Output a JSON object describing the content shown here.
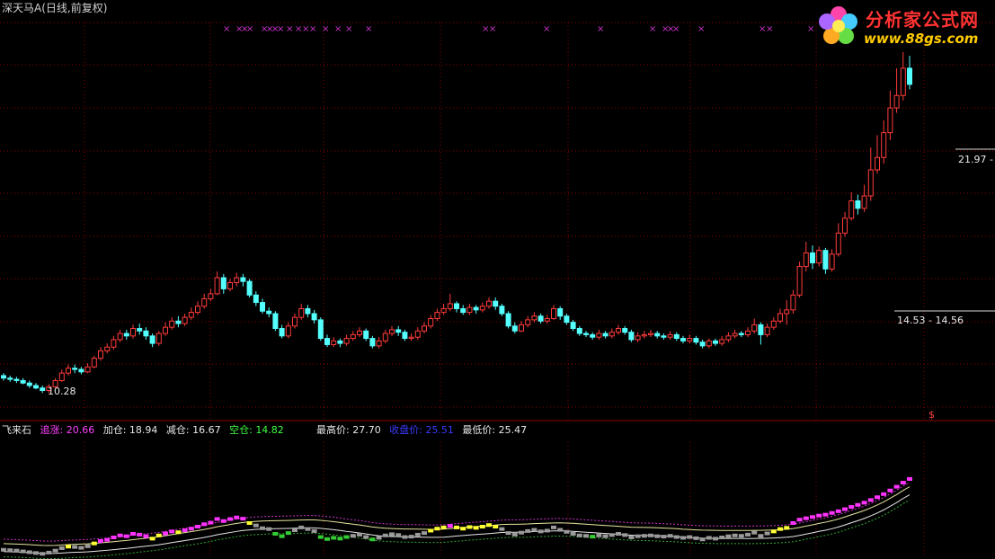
{
  "header": {
    "title": "深天马A",
    "period": "(日线,前复权)"
  },
  "logo": {
    "name": "分析家公式网",
    "url": "www.88gs.com"
  },
  "price_labels": {
    "high_box": "21.97 -",
    "mid_box": "14.53 - 14.56",
    "low_mark": "10.28"
  },
  "signal_marker": "$",
  "indicator": {
    "name": "飞来石",
    "items": [
      {
        "label": "追涨",
        "value": "20.66",
        "color": "#ff40ff"
      },
      {
        "label": "加仓",
        "value": "18.94",
        "color": "#e6e6e6"
      },
      {
        "label": "减仓",
        "value": "16.67",
        "color": "#e6e6e6"
      },
      {
        "label": "空仓",
        "value": "14.82",
        "color": "#40ff40"
      }
    ],
    "stats": [
      {
        "label": "最高价",
        "value": "27.70",
        "color": "#e6e6e6"
      },
      {
        "label": "收盘价",
        "value": "25.51",
        "color": "#3a3aff"
      },
      {
        "label": "最低价",
        "value": "25.47",
        "color": "#e6e6e6"
      }
    ]
  },
  "colors": {
    "up": "#ff3b3b",
    "down": "#54ffff",
    "grid": "#8b0000",
    "markers": "#cc33cc"
  },
  "chart_data": {
    "type": "candlestick",
    "series": [
      {
        "name": "price",
        "values": [
          [
            12.0,
            11.8,
            12.2,
            11.6
          ],
          [
            11.8,
            11.7,
            12.0,
            11.5
          ],
          [
            11.7,
            11.6,
            11.9,
            11.4
          ],
          [
            11.6,
            11.4,
            11.8,
            11.3
          ],
          [
            11.4,
            11.2,
            11.6,
            11.0
          ],
          [
            11.2,
            11.0,
            11.4,
            10.9
          ],
          [
            11.0,
            10.8,
            11.2,
            10.6
          ],
          [
            10.8,
            11.1,
            11.3,
            10.6
          ],
          [
            11.1,
            11.6,
            11.8,
            11.0
          ],
          [
            11.6,
            12.2,
            12.5,
            11.5
          ],
          [
            12.2,
            12.6,
            12.9,
            12.0
          ],
          [
            12.6,
            12.5,
            12.9,
            12.2
          ],
          [
            12.5,
            12.3,
            12.7,
            12.1
          ],
          [
            12.3,
            12.7,
            13.0,
            12.2
          ],
          [
            12.7,
            13.4,
            13.6,
            12.6
          ],
          [
            13.4,
            14.0,
            14.3,
            13.2
          ],
          [
            14.0,
            14.3,
            14.6,
            13.8
          ],
          [
            14.3,
            14.9,
            15.2,
            14.1
          ],
          [
            14.9,
            15.4,
            15.7,
            14.7
          ],
          [
            15.4,
            15.2,
            15.7,
            14.9
          ],
          [
            15.2,
            15.8,
            16.1,
            15.0
          ],
          [
            15.8,
            15.6,
            16.2,
            15.3
          ],
          [
            15.6,
            15.2,
            15.9,
            14.9
          ],
          [
            15.2,
            14.6,
            15.4,
            14.3
          ],
          [
            14.6,
            15.4,
            15.6,
            14.4
          ],
          [
            15.4,
            15.9,
            16.3,
            15.2
          ],
          [
            15.9,
            16.4,
            16.7,
            15.7
          ],
          [
            16.4,
            16.2,
            16.8,
            15.9
          ],
          [
            16.2,
            16.7,
            17.0,
            16.0
          ],
          [
            16.7,
            17.1,
            17.5,
            16.5
          ],
          [
            17.1,
            17.6,
            18.0,
            16.9
          ],
          [
            17.6,
            18.2,
            18.6,
            17.4
          ],
          [
            18.2,
            18.6,
            19.0,
            18.0
          ],
          [
            18.6,
            19.9,
            20.4,
            18.5
          ],
          [
            19.9,
            19.0,
            20.2,
            18.6
          ],
          [
            19.0,
            19.5,
            19.8,
            18.8
          ],
          [
            19.5,
            19.9,
            20.3,
            19.2
          ],
          [
            19.9,
            19.6,
            20.2,
            19.2
          ],
          [
            19.6,
            18.5,
            19.8,
            18.3
          ],
          [
            18.5,
            17.9,
            18.8,
            17.6
          ],
          [
            17.9,
            17.2,
            18.2,
            17.0
          ],
          [
            17.2,
            17.0,
            17.5,
            16.7
          ],
          [
            17.0,
            15.8,
            17.2,
            15.6
          ],
          [
            15.8,
            15.2,
            16.1,
            15.0
          ],
          [
            15.2,
            16.0,
            16.3,
            15.0
          ],
          [
            16.0,
            16.7,
            17.0,
            15.8
          ],
          [
            16.7,
            17.4,
            17.8,
            16.5
          ],
          [
            17.4,
            17.0,
            17.7,
            16.7
          ],
          [
            17.0,
            16.5,
            17.3,
            16.2
          ],
          [
            16.5,
            15.0,
            16.7,
            14.8
          ],
          [
            15.0,
            14.5,
            15.3,
            14.3
          ],
          [
            14.5,
            14.8,
            15.1,
            14.3
          ],
          [
            14.8,
            14.6,
            15.0,
            14.3
          ],
          [
            14.6,
            15.0,
            15.3,
            14.4
          ],
          [
            15.0,
            15.3,
            15.6,
            14.8
          ],
          [
            15.3,
            15.6,
            15.9,
            15.1
          ],
          [
            15.6,
            15.0,
            15.8,
            14.8
          ],
          [
            15.0,
            14.4,
            15.2,
            14.2
          ],
          [
            14.4,
            14.8,
            15.1,
            14.2
          ],
          [
            14.8,
            15.4,
            15.7,
            14.6
          ],
          [
            15.4,
            15.7,
            16.0,
            15.2
          ],
          [
            15.7,
            15.5,
            16.0,
            15.2
          ],
          [
            15.5,
            15.0,
            15.7,
            14.8
          ],
          [
            15.0,
            15.1,
            15.4,
            14.8
          ],
          [
            15.1,
            15.6,
            15.9,
            14.9
          ],
          [
            15.6,
            16.0,
            16.3,
            15.4
          ],
          [
            16.0,
            16.6,
            16.9,
            15.8
          ],
          [
            16.6,
            17.1,
            17.4,
            16.4
          ],
          [
            17.1,
            17.4,
            17.8,
            16.9
          ],
          [
            17.4,
            17.8,
            18.6,
            17.2
          ],
          [
            17.8,
            17.4,
            18.0,
            17.1
          ],
          [
            17.4,
            17.1,
            17.7,
            16.9
          ],
          [
            17.1,
            17.5,
            17.8,
            16.9
          ],
          [
            17.5,
            17.3,
            17.7,
            17.0
          ],
          [
            17.3,
            17.6,
            17.9,
            17.1
          ],
          [
            17.6,
            18.0,
            18.3,
            17.4
          ],
          [
            18.0,
            17.6,
            18.3,
            17.3
          ],
          [
            17.6,
            17.0,
            17.8,
            16.8
          ],
          [
            17.0,
            16.0,
            17.2,
            15.8
          ],
          [
            16.0,
            15.6,
            16.3,
            15.4
          ],
          [
            15.6,
            16.1,
            16.4,
            15.5
          ],
          [
            16.1,
            16.5,
            16.8,
            15.9
          ],
          [
            16.5,
            16.8,
            17.1,
            16.3
          ],
          [
            16.8,
            16.4,
            17.0,
            16.2
          ],
          [
            16.4,
            16.6,
            16.9,
            16.2
          ],
          [
            16.6,
            17.4,
            17.7,
            16.5
          ],
          [
            17.4,
            16.8,
            17.6,
            16.5
          ],
          [
            16.8,
            16.3,
            17.0,
            16.1
          ],
          [
            16.3,
            15.8,
            16.5,
            15.6
          ],
          [
            15.8,
            15.4,
            16.0,
            15.2
          ],
          [
            15.4,
            15.3,
            15.6,
            15.1
          ],
          [
            15.3,
            15.1,
            15.5,
            14.9
          ],
          [
            15.1,
            15.4,
            15.7,
            14.9
          ],
          [
            15.4,
            15.2,
            15.6,
            15.0
          ],
          [
            15.2,
            15.5,
            15.8,
            15.0
          ],
          [
            15.5,
            15.8,
            16.1,
            15.3
          ],
          [
            15.8,
            15.5,
            16.0,
            15.3
          ],
          [
            15.5,
            14.9,
            15.7,
            14.7
          ],
          [
            14.9,
            15.2,
            15.5,
            14.7
          ],
          [
            15.2,
            15.3,
            15.6,
            15.0
          ],
          [
            15.3,
            15.4,
            15.7,
            15.1
          ],
          [
            15.4,
            15.2,
            15.6,
            15.0
          ],
          [
            15.2,
            15.1,
            15.4,
            14.9
          ],
          [
            15.1,
            15.3,
            15.6,
            14.9
          ],
          [
            15.3,
            15.0,
            15.5,
            14.8
          ],
          [
            15.0,
            14.8,
            15.2,
            14.6
          ],
          [
            14.8,
            15.0,
            15.3,
            14.6
          ],
          [
            15.0,
            14.7,
            15.2,
            14.5
          ],
          [
            14.7,
            14.4,
            14.9,
            14.2
          ],
          [
            14.4,
            14.8,
            15.0,
            14.2
          ],
          [
            14.8,
            14.6,
            15.0,
            14.4
          ],
          [
            14.6,
            14.9,
            15.2,
            14.4
          ],
          [
            14.9,
            15.2,
            15.5,
            14.7
          ],
          [
            15.2,
            15.4,
            15.7,
            15.0
          ],
          [
            15.4,
            15.3,
            15.6,
            15.1
          ],
          [
            15.3,
            15.6,
            15.9,
            15.1
          ],
          [
            15.6,
            16.1,
            16.6,
            15.4
          ],
          [
            16.1,
            15.3,
            16.3,
            14.5
          ],
          [
            15.3,
            15.9,
            16.2,
            15.1
          ],
          [
            15.9,
            16.4,
            16.7,
            15.7
          ],
          [
            16.4,
            17.0,
            17.4,
            16.2
          ],
          [
            17.0,
            17.3,
            18.1,
            16.1
          ],
          [
            17.3,
            18.5,
            18.9,
            17.0
          ],
          [
            18.5,
            20.8,
            21.2,
            18.3
          ],
          [
            20.8,
            21.9,
            22.8,
            20.4
          ],
          [
            21.9,
            21.1,
            22.5,
            20.6
          ],
          [
            21.1,
            22.1,
            22.4,
            20.8
          ],
          [
            22.1,
            20.6,
            22.3,
            20.2
          ],
          [
            20.6,
            21.8,
            22.2,
            20.4
          ],
          [
            21.8,
            23.5,
            24.3,
            21.6
          ],
          [
            23.5,
            24.7,
            25.2,
            23.2
          ],
          [
            24.7,
            26.1,
            26.8,
            24.5
          ],
          [
            26.1,
            25.5,
            26.6,
            25.0
          ],
          [
            25.5,
            26.5,
            27.4,
            25.2
          ],
          [
            26.5,
            28.6,
            30.4,
            26.1
          ],
          [
            28.6,
            29.6,
            31.4,
            28.3
          ],
          [
            29.6,
            31.6,
            32.6,
            29.1
          ],
          [
            31.6,
            33.6,
            35.0,
            31.0
          ],
          [
            33.6,
            34.6,
            36.8,
            33.2
          ],
          [
            34.6,
            36.8,
            38.1,
            34.2
          ],
          [
            36.8,
            35.5,
            37.8,
            35.1
          ]
        ]
      }
    ]
  }
}
